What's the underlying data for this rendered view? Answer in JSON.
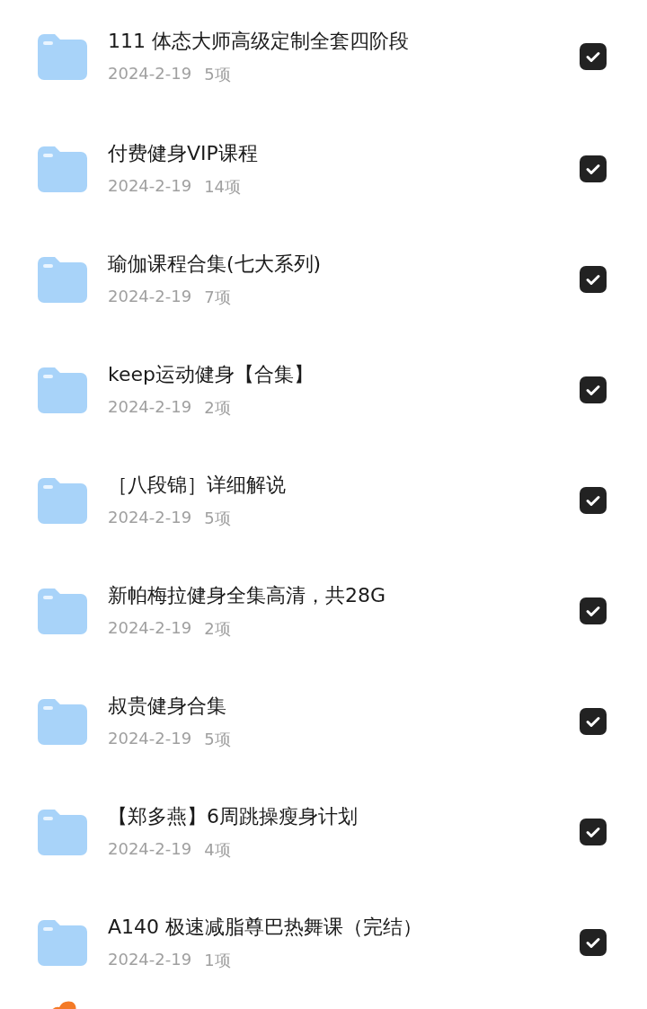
{
  "folders": [
    {
      "name": "111 体态大师高级定制全套四阶段",
      "date": "2024-2-19",
      "count": "5项",
      "checked": true
    },
    {
      "name": "付费健身VIP课程",
      "date": "2024-2-19",
      "count": "14项",
      "checked": true
    },
    {
      "name": "瑜伽课程合集(七大系列)",
      "date": "2024-2-19",
      "count": "7项",
      "checked": true
    },
    {
      "name": "keep运动健身【合集】",
      "date": "2024-2-19",
      "count": "2项",
      "checked": true
    },
    {
      "name": "［八段锦］详细解说",
      "date": "2024-2-19",
      "count": "5项",
      "checked": true
    },
    {
      "name": "新帕梅拉健身全集高清，共28G",
      "date": "2024-2-19",
      "count": "2项",
      "checked": true
    },
    {
      "name": "叔贵健身合集",
      "date": "2024-2-19",
      "count": "5项",
      "checked": true
    },
    {
      "name": "【郑多燕】6周跳操瘦身计划",
      "date": "2024-2-19",
      "count": "4项",
      "checked": true
    },
    {
      "name": "A140 极速减脂尊巴热舞课（完结）",
      "date": "2024-2-19",
      "count": "1项",
      "checked": true
    }
  ]
}
